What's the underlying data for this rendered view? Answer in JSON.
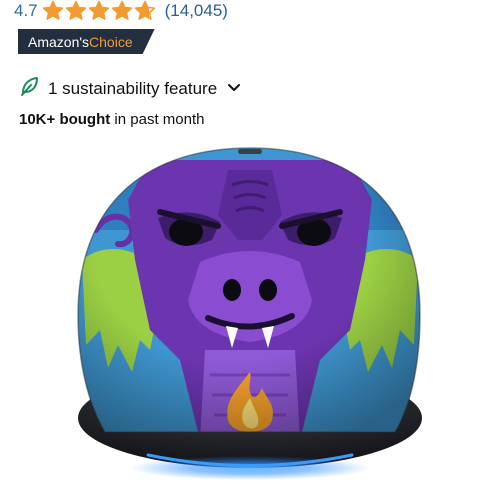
{
  "rating": {
    "value": "4.7",
    "stars_out_of_5": 4.7,
    "count": "(14,045)",
    "star_color": "#f49b2f"
  },
  "badge": {
    "part1": "Amazon's ",
    "part2": "Choice",
    "background": "#232f3e",
    "accent": "#f29a38"
  },
  "sustainability": {
    "icon": "leaf-icon",
    "label": "1 sustainability feature",
    "dropdown_icon": "chevron-down-icon"
  },
  "purchases": {
    "bold": "10K+ bought",
    "rest": " in past month"
  },
  "product_image": {
    "subject": "spherical smart speaker with purple dragon face design",
    "light_ring_color": "#2f8fff"
  }
}
